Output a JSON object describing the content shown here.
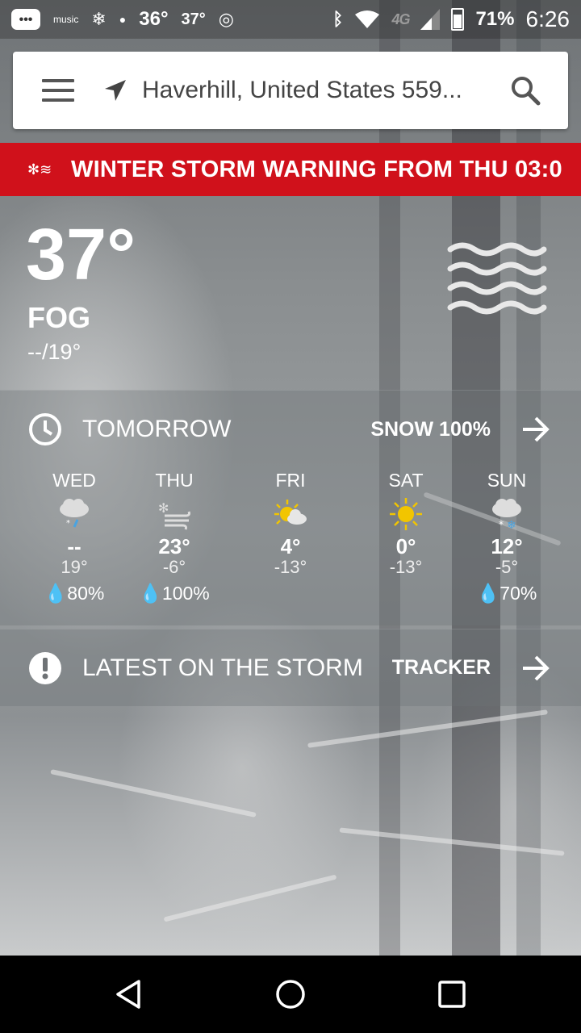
{
  "status_bar": {
    "left_icons": [
      "messages-icon",
      "amazon-music-icon",
      "snowflake-icon",
      "leaf-icon"
    ],
    "music_label": "music",
    "temp_a": "36°",
    "temp_b": "37°",
    "lte_label": "4G",
    "battery": "71%",
    "time": "6:26"
  },
  "search": {
    "location": "Haverhill, United States 559..."
  },
  "alert": {
    "text": "WINTER STORM WARNING FROM THU 03:0"
  },
  "current": {
    "temperature": "37°",
    "condition": "FOG",
    "hi_lo": "--/19°",
    "icon": "fog-icon"
  },
  "tomorrow": {
    "label": "TOMORROW",
    "precip_link": "SNOW 100%"
  },
  "forecast": [
    {
      "day": "WED",
      "icon": "rain-snow-icon",
      "high": "--",
      "low": "19°",
      "precip": "80%"
    },
    {
      "day": "THU",
      "icon": "snow-wind-icon",
      "high": "23°",
      "low": "-6°",
      "precip": "100%"
    },
    {
      "day": "FRI",
      "icon": "partly-cloudy-icon",
      "high": "4°",
      "low": "-13°",
      "precip": ""
    },
    {
      "day": "SAT",
      "icon": "sunny-icon",
      "high": "0°",
      "low": "-13°",
      "precip": ""
    },
    {
      "day": "SUN",
      "icon": "snow-icon",
      "high": "12°",
      "low": "-5°",
      "precip": "70%"
    }
  ],
  "storm": {
    "label": "LATEST ON THE STORM",
    "link": "TRACKER"
  },
  "colors": {
    "alert_red": "#d0111b",
    "sun_yellow": "#f2c500"
  }
}
